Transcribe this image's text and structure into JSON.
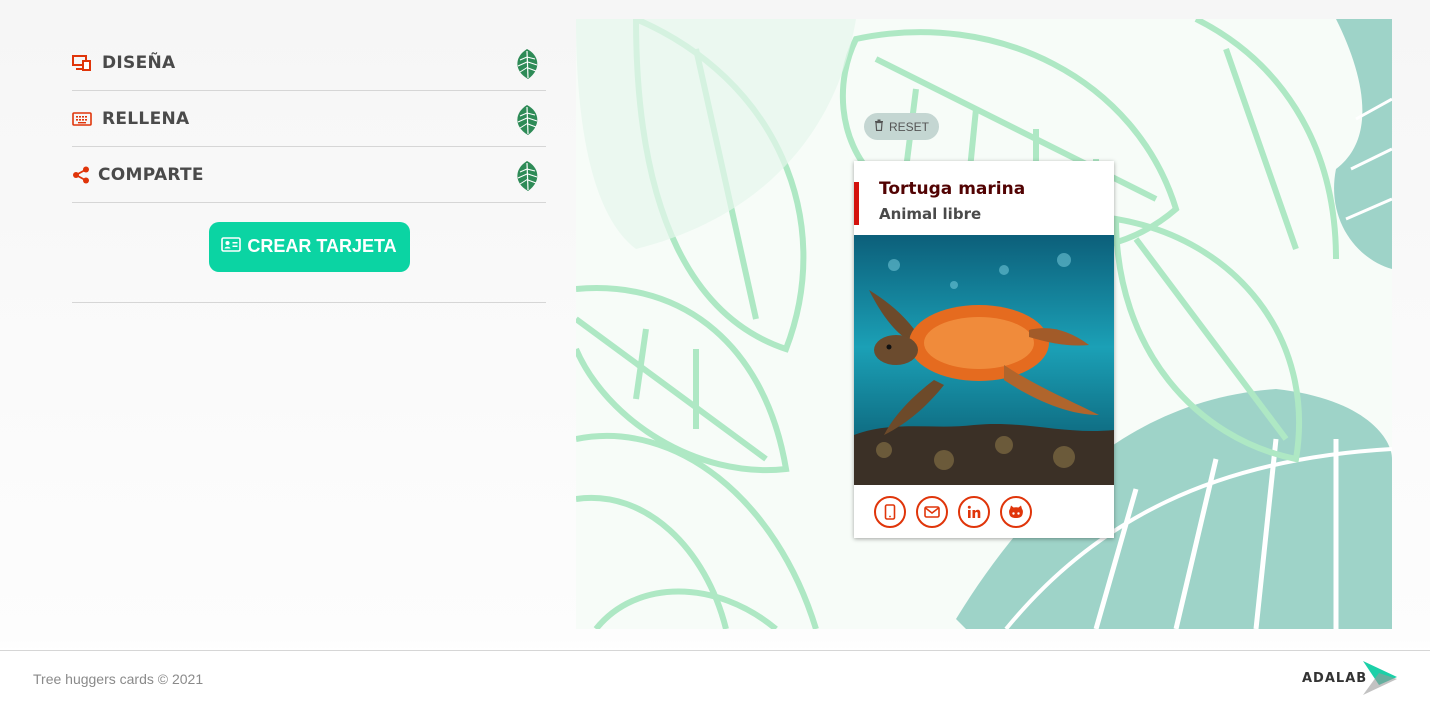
{
  "nav": {
    "items": [
      {
        "label": "DISEÑA",
        "icon": "design-icon"
      },
      {
        "label": "RELLENA",
        "icon": "keyboard-icon"
      },
      {
        "label": "COMPARTE",
        "icon": "share-icon"
      }
    ],
    "create_button": "CREAR TARJETA"
  },
  "preview": {
    "reset_label": "RESET",
    "card": {
      "name": "Tortuga marina",
      "job": "Animal libre",
      "socials": [
        "phone-icon",
        "email-icon",
        "linkedin-icon",
        "github-icon"
      ]
    }
  },
  "footer": {
    "copyright": "Tree huggers cards © 2021",
    "logo": "ADALAB"
  },
  "colors": {
    "accent_red": "#e0350a",
    "create_green": "#0bd4a3",
    "name_color": "#520303",
    "leaf_green": "#2e8b57"
  }
}
